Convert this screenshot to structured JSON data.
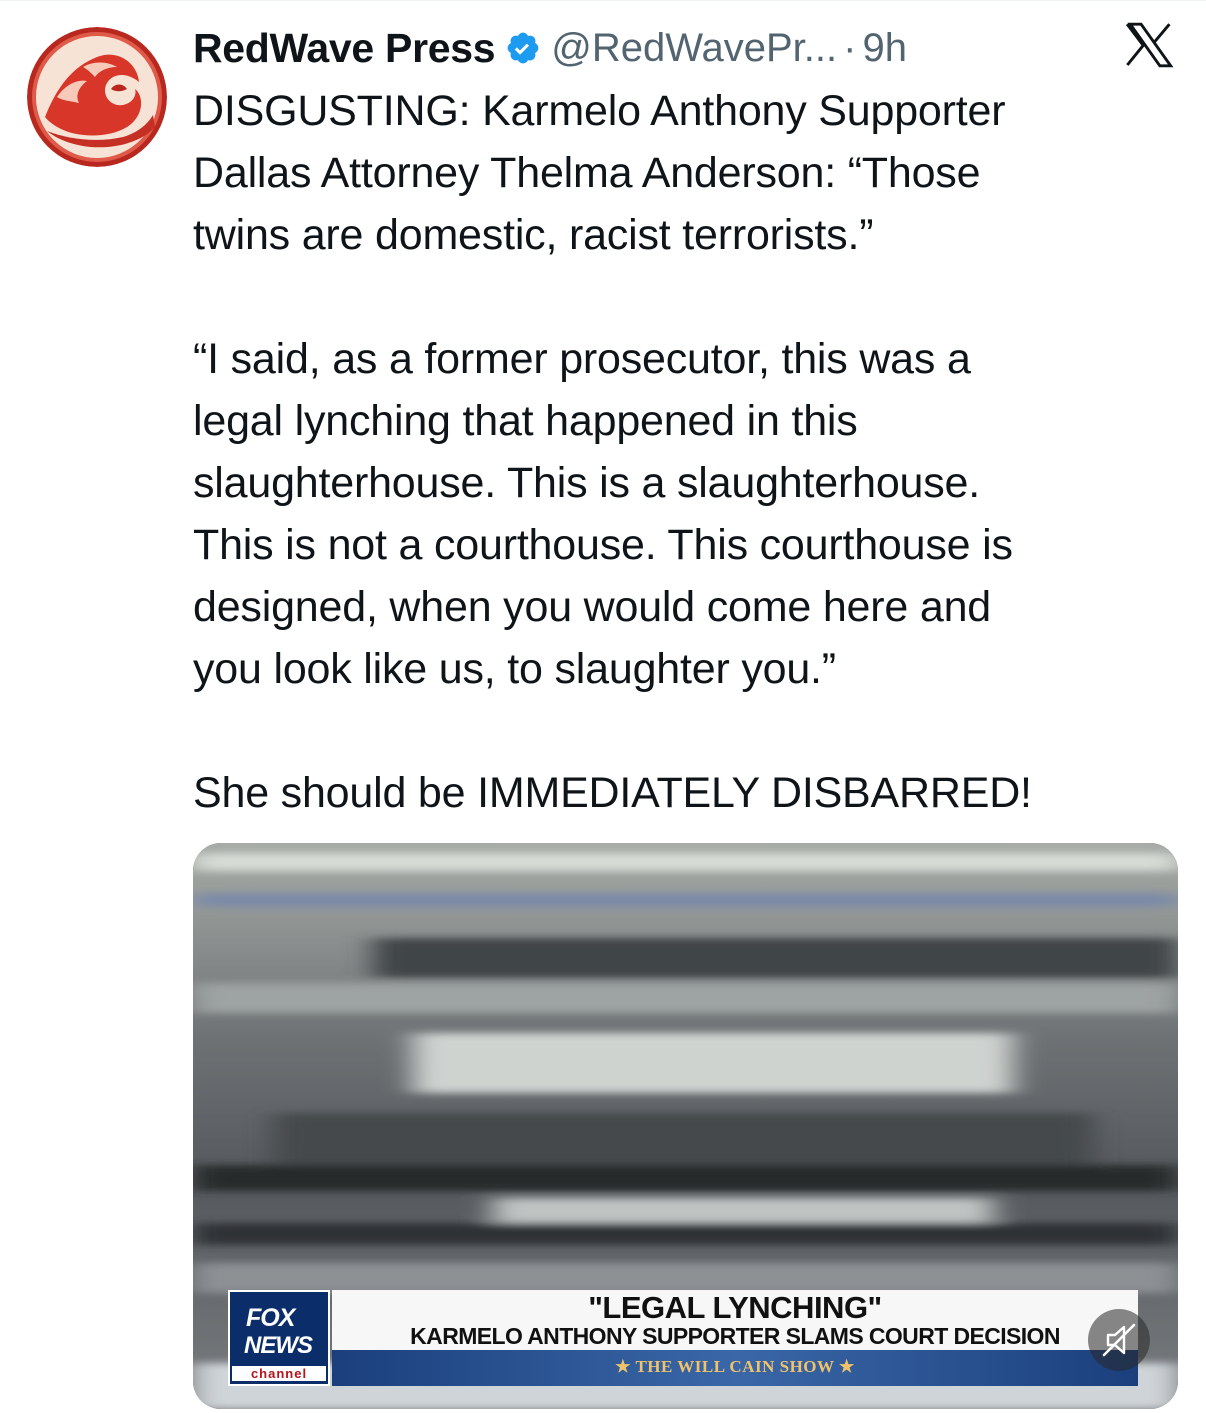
{
  "author": {
    "display_name": "RedWave Press",
    "handle": "@RedWavePr...",
    "separator": "·",
    "time": "9h",
    "verified": true
  },
  "icons": {
    "avatar": "red-wave-logo",
    "verified": "verified-badge-icon",
    "platform": "x-logo-icon",
    "mute": "volume-muted-icon"
  },
  "tweet": {
    "text": "DISGUSTING: Karmelo Anthony Supporter\nDallas Attorney Thelma Anderson: “Those\ntwins are domestic, racist terrorists.”\n\n“I said, as a former prosecutor, this was a\nlegal lynching that happened in this\nslaughterhouse. This is a slaughterhouse.\nThis is not a courthouse. This courthouse is\ndesigned, when you would come here and\nyou look like us, to slaughter you.”\n\nShe should be IMMEDIATELY DISBARRED!"
  },
  "media": {
    "logo_line1": "FOX",
    "logo_line2": "NEWS",
    "logo_line3": "channel",
    "headline": "\"LEGAL LYNCHING\"",
    "subheadline": "KARMELO ANTHONY SUPPORTER SLAMS COURT DECISION",
    "show_name": "★ THE WILL CAIN SHOW ★"
  },
  "colors": {
    "verified_blue": "#1d9bf0",
    "avatar_red": "#e03a2f",
    "text": "#0f1419",
    "secondary": "#536471",
    "fox_blue": "#0b2e6b"
  }
}
